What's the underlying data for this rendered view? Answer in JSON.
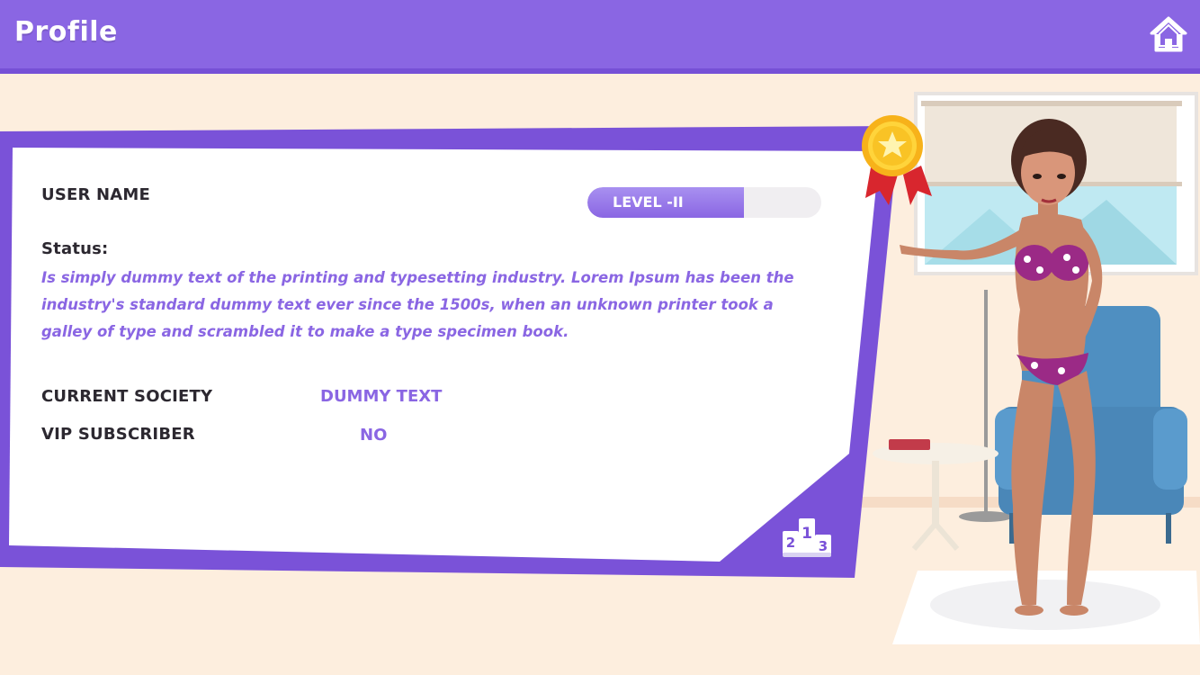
{
  "header": {
    "title": "Profile",
    "home_icon": "home-icon"
  },
  "profile": {
    "username_label": "USER NAME",
    "level_label": "LEVEL -II",
    "level_progress": 0.67,
    "status_label": "Status:",
    "status_text": "Is simply dummy text of the printing and typesetting industry. Lorem Ipsum has been the industry's standard dummy text ever since the 1500s, when an unknown printer took a galley of type and scrambled it to make a type specimen book.",
    "society_label": "CURRENT SOCIETY",
    "society_value": "DUMMY TEXT",
    "vip_label": "VIP SUBSCRIBER",
    "vip_value": "NO",
    "leaderboard_icon": "leaderboard-podium-icon",
    "leaderboard_digits": [
      "2",
      "1",
      "3"
    ],
    "medal_icon": "gold-medal-icon"
  },
  "colors": {
    "accent": "#8a66e3",
    "background": "#fdeede",
    "card": "#ffffff",
    "text_dark": "#2c2830"
  }
}
